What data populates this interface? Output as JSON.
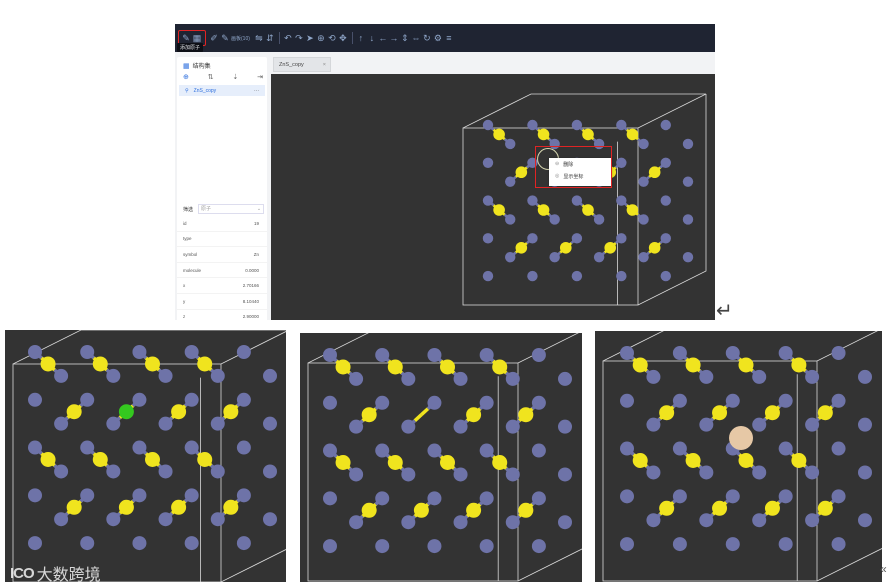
{
  "toolbar": {
    "tooltip": "添加原子",
    "text_item": "画板(10)",
    "icons": [
      "pen-icon",
      "grid-icon",
      "edit-icon",
      "pencil-icon",
      "flip-h-icon",
      "flip-v-icon",
      "undo-icon",
      "redo-icon",
      "select-icon",
      "zoom-icon",
      "rotate-icon",
      "move-icon",
      "arrow-up-icon",
      "arrow-down-icon",
      "arrow-left-icon",
      "arrow-right-icon",
      "rotate-x-icon",
      "rotate-y-icon",
      "rotate-z-icon",
      "settings-icon",
      "save-icon"
    ]
  },
  "sidebar": {
    "title": "结构集",
    "item": "ZnS_copy",
    "item_more": "···"
  },
  "properties": {
    "label": "筛选",
    "select_value": "原子",
    "rows": [
      {
        "key": "id",
        "value": "19"
      },
      {
        "key": "type",
        "value": ""
      },
      {
        "key": "symbol",
        "value": "Zn"
      },
      {
        "key": "molecule",
        "value": "0.0000"
      },
      {
        "key": "x",
        "value": "2.70166"
      },
      {
        "key": "y",
        "value": "8.10440"
      },
      {
        "key": "z",
        "value": "2.90000"
      }
    ]
  },
  "tab": {
    "label": "ZnS_copy",
    "close": "×"
  },
  "context_menu": {
    "items": [
      {
        "label": "删除",
        "icon": "delete-icon"
      },
      {
        "label": "显示坐标",
        "icon": "coordinates-icon"
      }
    ]
  },
  "marks": {
    "return": "↵",
    "edge": "«"
  },
  "watermark": {
    "logo": "ICO",
    "text": "大数跨境"
  },
  "colors": {
    "toolbar_bg": "#1f2432",
    "viewport_bg": "#333333",
    "atom_s": "#f0e41e",
    "atom_zn": "#6e73a8",
    "atom_selected": "#34c81f",
    "atom_added": "#e6c8a6",
    "highlight": "#e02424"
  }
}
